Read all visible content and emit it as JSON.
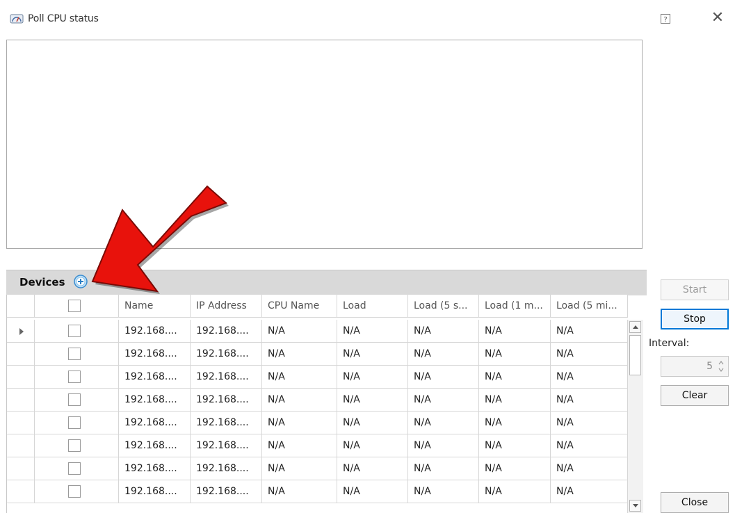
{
  "window": {
    "title": "Poll CPU status",
    "help_icon": "help-icon",
    "close_icon": "close-icon"
  },
  "log": {
    "content": ""
  },
  "devices": {
    "label": "Devices",
    "add_icon": "add-icon"
  },
  "grid": {
    "columns": [
      "",
      "Name",
      "IP Address",
      "CPU Name",
      "Load",
      "Load (5 s...",
      "Load (1 m...",
      "Load (5 mi..."
    ],
    "rows": [
      [
        "192.168....",
        "192.168....",
        "N/A",
        "N/A",
        "N/A",
        "N/A",
        "N/A"
      ],
      [
        "192.168....",
        "192.168....",
        "N/A",
        "N/A",
        "N/A",
        "N/A",
        "N/A"
      ],
      [
        "192.168....",
        "192.168....",
        "N/A",
        "N/A",
        "N/A",
        "N/A",
        "N/A"
      ],
      [
        "192.168....",
        "192.168....",
        "N/A",
        "N/A",
        "N/A",
        "N/A",
        "N/A"
      ],
      [
        "192.168....",
        "192.168....",
        "N/A",
        "N/A",
        "N/A",
        "N/A",
        "N/A"
      ],
      [
        "192.168....",
        "192.168....",
        "N/A",
        "N/A",
        "N/A",
        "N/A",
        "N/A"
      ],
      [
        "192.168....",
        "192.168....",
        "N/A",
        "N/A",
        "N/A",
        "N/A",
        "N/A"
      ],
      [
        "192.168....",
        "192.168....",
        "N/A",
        "N/A",
        "N/A",
        "N/A",
        "N/A"
      ]
    ]
  },
  "controls": {
    "start_label": "Start",
    "stop_label": "Stop",
    "interval_label": "Interval:",
    "interval_value": "5",
    "clear_label": "Clear",
    "close_label": "Close"
  },
  "annotation": {
    "arrow_color": "#e8120c"
  }
}
